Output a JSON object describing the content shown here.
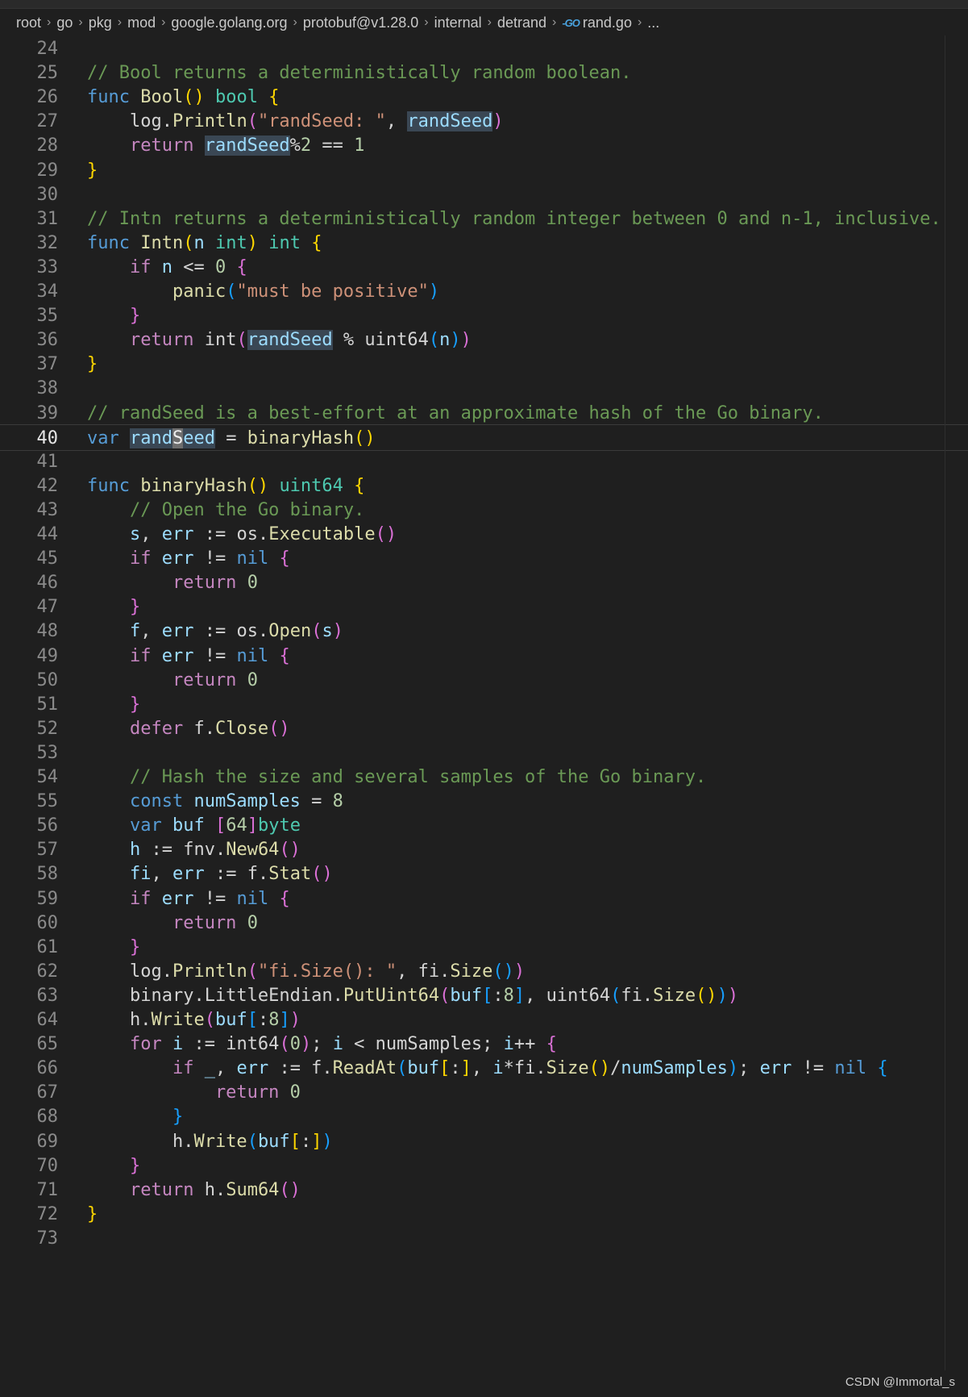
{
  "breadcrumb": {
    "items": [
      "root",
      "go",
      "pkg",
      "mod",
      "google.golang.org",
      "protobuf@v1.28.0",
      "internal",
      "detrand"
    ],
    "file_icon": "go-file-icon",
    "file": "rand.go",
    "more": "..."
  },
  "editor": {
    "current_line": 40,
    "lines": [
      {
        "n": "24",
        "tokens": []
      },
      {
        "n": "25",
        "tokens": [
          [
            "cm",
            "// Bool returns a deterministically random boolean."
          ]
        ]
      },
      {
        "n": "26",
        "tokens": [
          [
            "k",
            "func "
          ],
          [
            "f",
            "Bool"
          ],
          [
            "b1",
            "()"
          ],
          [
            "p",
            " "
          ],
          [
            "t",
            "bool"
          ],
          [
            "p",
            " "
          ],
          [
            "b1",
            "{"
          ]
        ]
      },
      {
        "n": "27",
        "tokens": [
          [
            "p",
            "    log."
          ],
          [
            "f",
            "Println"
          ],
          [
            "b2",
            "("
          ],
          [
            "s",
            "\"randSeed: \""
          ],
          [
            "p",
            ", "
          ],
          [
            "v hl",
            "randSeed"
          ],
          [
            "b2",
            ")"
          ]
        ]
      },
      {
        "n": "28",
        "tokens": [
          [
            "c",
            "    return "
          ],
          [
            "v hl",
            "randSeed"
          ],
          [
            "p",
            "%"
          ],
          [
            "n",
            "2"
          ],
          [
            "p",
            " == "
          ],
          [
            "n",
            "1"
          ]
        ]
      },
      {
        "n": "29",
        "tokens": [
          [
            "b1",
            "}"
          ]
        ]
      },
      {
        "n": "30",
        "tokens": []
      },
      {
        "n": "31",
        "tokens": [
          [
            "cm",
            "// Intn returns a deterministically random integer between 0 and n-1, inclusive."
          ]
        ]
      },
      {
        "n": "32",
        "tokens": [
          [
            "k",
            "func "
          ],
          [
            "f",
            "Intn"
          ],
          [
            "b1",
            "("
          ],
          [
            "v",
            "n"
          ],
          [
            "p",
            " "
          ],
          [
            "t",
            "int"
          ],
          [
            "b1",
            ")"
          ],
          [
            "p",
            " "
          ],
          [
            "t",
            "int"
          ],
          [
            "p",
            " "
          ],
          [
            "b1",
            "{"
          ]
        ]
      },
      {
        "n": "33",
        "tokens": [
          [
            "c",
            "    if "
          ],
          [
            "v",
            "n"
          ],
          [
            "p",
            " <= "
          ],
          [
            "n",
            "0"
          ],
          [
            "p",
            " "
          ],
          [
            "b2",
            "{"
          ]
        ]
      },
      {
        "n": "34",
        "tokens": [
          [
            "p",
            "        "
          ],
          [
            "f",
            "panic"
          ],
          [
            "b3",
            "("
          ],
          [
            "s",
            "\"must be positive\""
          ],
          [
            "b3",
            ")"
          ]
        ]
      },
      {
        "n": "35",
        "tokens": [
          [
            "b2",
            "    }"
          ]
        ]
      },
      {
        "n": "36",
        "tokens": [
          [
            "c",
            "    return "
          ],
          [
            "p",
            "int"
          ],
          [
            "b2",
            "("
          ],
          [
            "v hl",
            "randSeed"
          ],
          [
            "p",
            " % "
          ],
          [
            "p",
            "uint64"
          ],
          [
            "b3",
            "("
          ],
          [
            "v",
            "n"
          ],
          [
            "b3",
            ")"
          ],
          [
            "b2",
            ")"
          ]
        ]
      },
      {
        "n": "37",
        "tokens": [
          [
            "b1",
            "}"
          ]
        ]
      },
      {
        "n": "38",
        "tokens": []
      },
      {
        "n": "39",
        "tokens": [
          [
            "cm",
            "// randSeed is a best-effort at an approximate hash of the Go binary."
          ]
        ]
      },
      {
        "n": "40",
        "tokens": [
          [
            "k",
            "var "
          ],
          [
            "v hl",
            "rand"
          ],
          [
            "v caret",
            "S"
          ],
          [
            "v hl",
            "eed"
          ],
          [
            "p",
            " = "
          ],
          [
            "f",
            "binaryHash"
          ],
          [
            "b1",
            "()"
          ]
        ]
      },
      {
        "n": "41",
        "tokens": []
      },
      {
        "n": "42",
        "tokens": [
          [
            "k",
            "func "
          ],
          [
            "f",
            "binaryHash"
          ],
          [
            "b1",
            "()"
          ],
          [
            "p",
            " "
          ],
          [
            "t",
            "uint64"
          ],
          [
            "p",
            " "
          ],
          [
            "b1",
            "{"
          ]
        ]
      },
      {
        "n": "43",
        "tokens": [
          [
            "cm",
            "    // Open the Go binary."
          ]
        ]
      },
      {
        "n": "44",
        "tokens": [
          [
            "v",
            "    s"
          ],
          [
            "p",
            ", "
          ],
          [
            "v",
            "err"
          ],
          [
            "p",
            " := os."
          ],
          [
            "f",
            "Executable"
          ],
          [
            "b2",
            "()"
          ]
        ]
      },
      {
        "n": "45",
        "tokens": [
          [
            "c",
            "    if "
          ],
          [
            "v",
            "err"
          ],
          [
            "p",
            " != "
          ],
          [
            "k",
            "nil"
          ],
          [
            "p",
            " "
          ],
          [
            "b2",
            "{"
          ]
        ]
      },
      {
        "n": "46",
        "tokens": [
          [
            "c",
            "        return "
          ],
          [
            "n",
            "0"
          ]
        ]
      },
      {
        "n": "47",
        "tokens": [
          [
            "b2",
            "    }"
          ]
        ]
      },
      {
        "n": "48",
        "tokens": [
          [
            "v",
            "    f"
          ],
          [
            "p",
            ", "
          ],
          [
            "v",
            "err"
          ],
          [
            "p",
            " := os."
          ],
          [
            "f",
            "Open"
          ],
          [
            "b2",
            "("
          ],
          [
            "v",
            "s"
          ],
          [
            "b2",
            ")"
          ]
        ]
      },
      {
        "n": "49",
        "tokens": [
          [
            "c",
            "    if "
          ],
          [
            "v",
            "err"
          ],
          [
            "p",
            " != "
          ],
          [
            "k",
            "nil"
          ],
          [
            "p",
            " "
          ],
          [
            "b2",
            "{"
          ]
        ]
      },
      {
        "n": "50",
        "tokens": [
          [
            "c",
            "        return "
          ],
          [
            "n",
            "0"
          ]
        ]
      },
      {
        "n": "51",
        "tokens": [
          [
            "b2",
            "    }"
          ]
        ]
      },
      {
        "n": "52",
        "tokens": [
          [
            "c",
            "    defer "
          ],
          [
            "p",
            "f."
          ],
          [
            "f",
            "Close"
          ],
          [
            "b2",
            "()"
          ]
        ]
      },
      {
        "n": "53",
        "tokens": []
      },
      {
        "n": "54",
        "tokens": [
          [
            "cm",
            "    // Hash the size and several samples of the Go binary."
          ]
        ]
      },
      {
        "n": "55",
        "tokens": [
          [
            "k",
            "    const "
          ],
          [
            "v",
            "numSamples"
          ],
          [
            "p",
            " = "
          ],
          [
            "n",
            "8"
          ]
        ]
      },
      {
        "n": "56",
        "tokens": [
          [
            "k",
            "    var "
          ],
          [
            "v",
            "buf"
          ],
          [
            "p",
            " "
          ],
          [
            "b2",
            "["
          ],
          [
            "n",
            "64"
          ],
          [
            "b2",
            "]"
          ],
          [
            "t",
            "byte"
          ]
        ]
      },
      {
        "n": "57",
        "tokens": [
          [
            "v",
            "    h"
          ],
          [
            "p",
            " := fnv."
          ],
          [
            "f",
            "New64"
          ],
          [
            "b2",
            "()"
          ]
        ]
      },
      {
        "n": "58",
        "tokens": [
          [
            "v",
            "    fi"
          ],
          [
            "p",
            ", "
          ],
          [
            "v",
            "err"
          ],
          [
            "p",
            " := f."
          ],
          [
            "f",
            "Stat"
          ],
          [
            "b2",
            "()"
          ]
        ]
      },
      {
        "n": "59",
        "tokens": [
          [
            "c",
            "    if "
          ],
          [
            "v",
            "err"
          ],
          [
            "p",
            " != "
          ],
          [
            "k",
            "nil"
          ],
          [
            "p",
            " "
          ],
          [
            "b2",
            "{"
          ]
        ]
      },
      {
        "n": "60",
        "tokens": [
          [
            "c",
            "        return "
          ],
          [
            "n",
            "0"
          ]
        ]
      },
      {
        "n": "61",
        "tokens": [
          [
            "b2",
            "    }"
          ]
        ]
      },
      {
        "n": "62",
        "tokens": [
          [
            "p",
            "    log."
          ],
          [
            "f",
            "Println"
          ],
          [
            "b2",
            "("
          ],
          [
            "s",
            "\"fi.Size(): \""
          ],
          [
            "p",
            ", fi."
          ],
          [
            "f",
            "Size"
          ],
          [
            "b3",
            "()"
          ],
          [
            "b2",
            ")"
          ]
        ]
      },
      {
        "n": "63",
        "tokens": [
          [
            "p",
            "    binary.LittleEndian."
          ],
          [
            "f",
            "PutUint64"
          ],
          [
            "b2",
            "("
          ],
          [
            "v",
            "buf"
          ],
          [
            "b3",
            "["
          ],
          [
            "p",
            ":"
          ],
          [
            "n",
            "8"
          ],
          [
            "b3",
            "]"
          ],
          [
            "p",
            ", uint64"
          ],
          [
            "b3",
            "("
          ],
          [
            "p",
            "fi."
          ],
          [
            "f",
            "Size"
          ],
          [
            "b1",
            "()"
          ],
          [
            "b3",
            ")"
          ],
          [
            "b2",
            ")"
          ]
        ]
      },
      {
        "n": "64",
        "tokens": [
          [
            "p",
            "    h."
          ],
          [
            "f",
            "Write"
          ],
          [
            "b2",
            "("
          ],
          [
            "v",
            "buf"
          ],
          [
            "b3",
            "["
          ],
          [
            "p",
            ":"
          ],
          [
            "n",
            "8"
          ],
          [
            "b3",
            "]"
          ],
          [
            "b2",
            ")"
          ]
        ]
      },
      {
        "n": "65",
        "tokens": [
          [
            "c",
            "    for "
          ],
          [
            "v",
            "i"
          ],
          [
            "p",
            " := int64"
          ],
          [
            "b2",
            "("
          ],
          [
            "n",
            "0"
          ],
          [
            "b2",
            ")"
          ],
          [
            "p",
            "; "
          ],
          [
            "v",
            "i"
          ],
          [
            "p",
            " < numSamples; "
          ],
          [
            "v",
            "i"
          ],
          [
            "p",
            "++ "
          ],
          [
            "b2",
            "{"
          ]
        ]
      },
      {
        "n": "66",
        "tokens": [
          [
            "c",
            "        if "
          ],
          [
            "v",
            "_"
          ],
          [
            "p",
            ", "
          ],
          [
            "v",
            "err"
          ],
          [
            "p",
            " := f."
          ],
          [
            "f",
            "ReadAt"
          ],
          [
            "b3",
            "("
          ],
          [
            "v",
            "buf"
          ],
          [
            "b1",
            "["
          ],
          [
            "p",
            ":"
          ],
          [
            "b1",
            "]"
          ],
          [
            "p",
            ", "
          ],
          [
            "v",
            "i"
          ],
          [
            "p",
            "*fi."
          ],
          [
            "f",
            "Size"
          ],
          [
            "b1",
            "()"
          ],
          [
            "p",
            "/"
          ],
          [
            "v",
            "numSamples"
          ],
          [
            "b3",
            ")"
          ],
          [
            "p",
            "; "
          ],
          [
            "v",
            "err"
          ],
          [
            "p",
            " != "
          ],
          [
            "k",
            "nil"
          ],
          [
            "p",
            " "
          ],
          [
            "b3",
            "{"
          ]
        ]
      },
      {
        "n": "67",
        "tokens": [
          [
            "c",
            "            return "
          ],
          [
            "n",
            "0"
          ]
        ]
      },
      {
        "n": "68",
        "tokens": [
          [
            "b3",
            "        }"
          ]
        ]
      },
      {
        "n": "69",
        "tokens": [
          [
            "p",
            "        h."
          ],
          [
            "f",
            "Write"
          ],
          [
            "b3",
            "("
          ],
          [
            "v",
            "buf"
          ],
          [
            "b1",
            "["
          ],
          [
            "p",
            ":"
          ],
          [
            "b1",
            "]"
          ],
          [
            "b3",
            ")"
          ]
        ]
      },
      {
        "n": "70",
        "tokens": [
          [
            "b2",
            "    }"
          ]
        ]
      },
      {
        "n": "71",
        "tokens": [
          [
            "c",
            "    return "
          ],
          [
            "p",
            "h."
          ],
          [
            "f",
            "Sum64"
          ],
          [
            "b2",
            "()"
          ]
        ]
      },
      {
        "n": "72",
        "tokens": [
          [
            "b1",
            "}"
          ]
        ]
      },
      {
        "n": "73",
        "tokens": []
      }
    ]
  },
  "watermark": "CSDN @Immortal_s"
}
